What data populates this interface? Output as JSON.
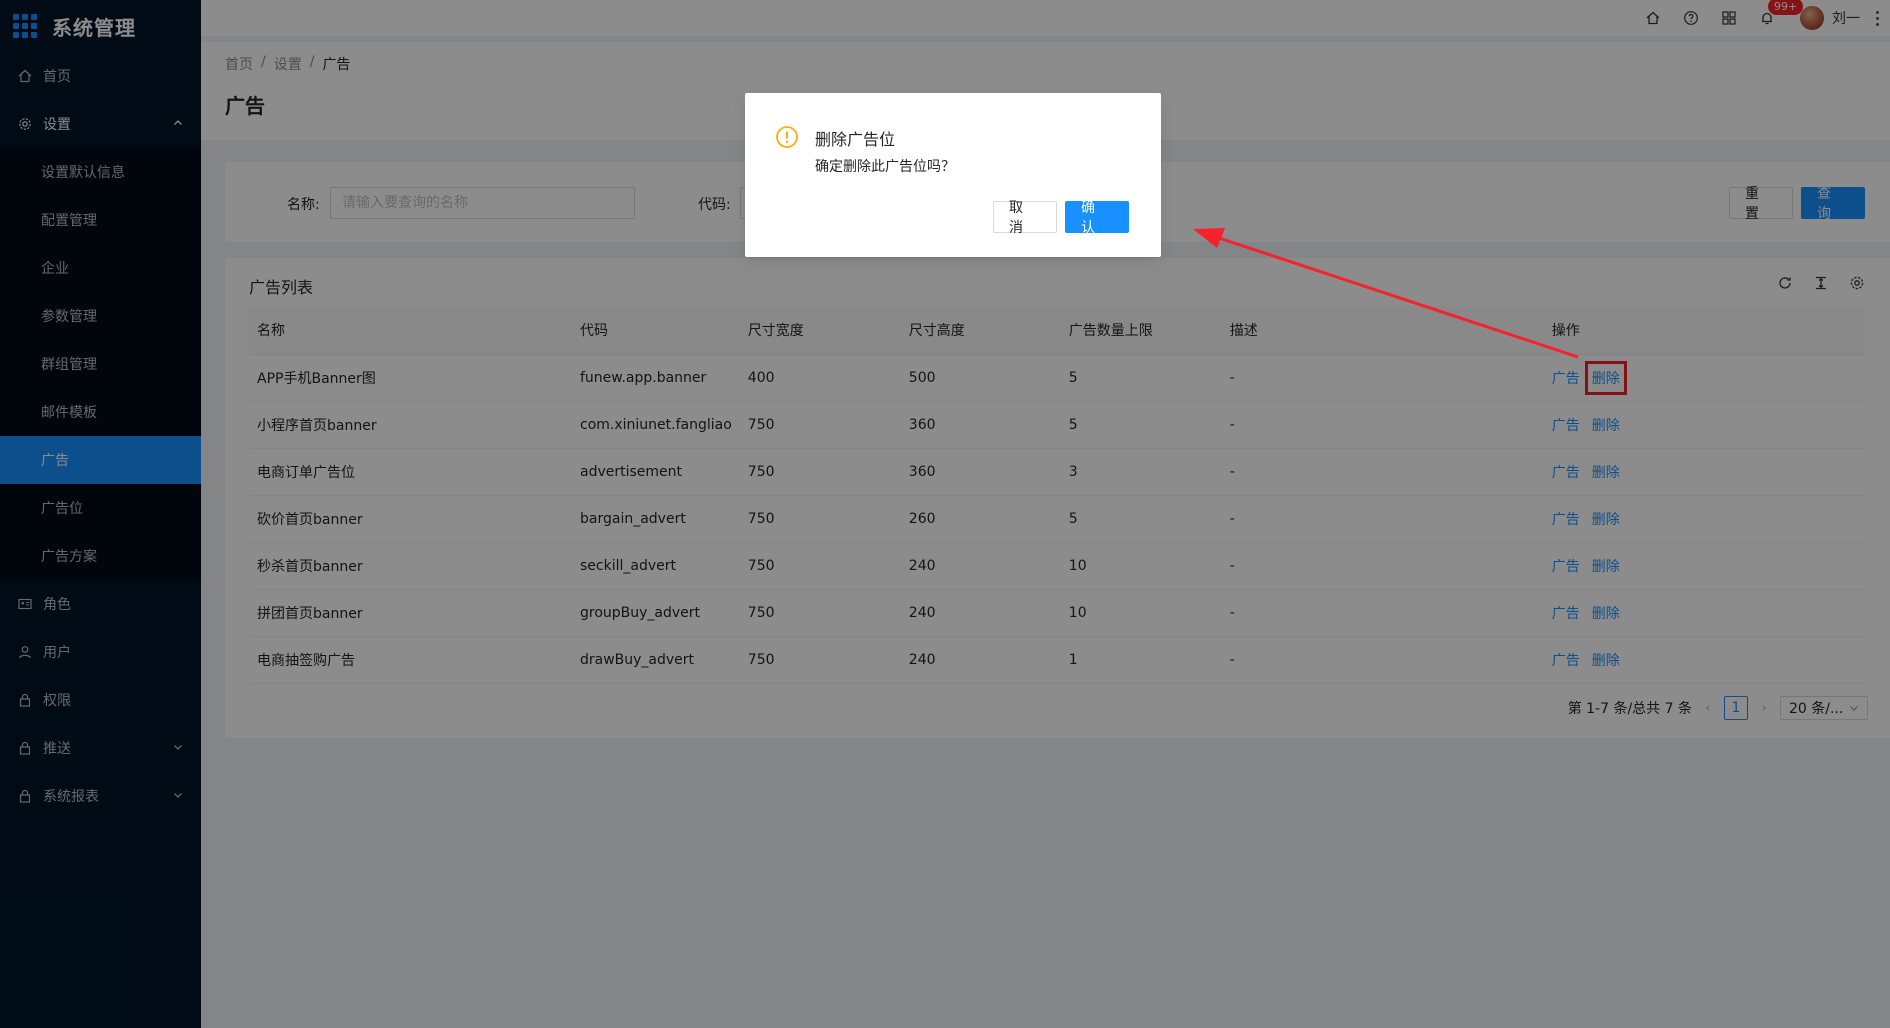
{
  "app": {
    "title": "系统管理"
  },
  "sidebar": {
    "items": [
      {
        "label": "首页",
        "icon": "home-icon"
      },
      {
        "label": "设置",
        "icon": "gear-icon",
        "open": true,
        "children": [
          {
            "label": "设置默认信息"
          },
          {
            "label": "配置管理"
          },
          {
            "label": "企业"
          },
          {
            "label": "参数管理"
          },
          {
            "label": "群组管理"
          },
          {
            "label": "邮件模板"
          },
          {
            "label": "广告",
            "active": true
          },
          {
            "label": "广告位"
          },
          {
            "label": "广告方案"
          }
        ]
      },
      {
        "label": "角色",
        "icon": "id-card-icon"
      },
      {
        "label": "用户",
        "icon": "user-icon"
      },
      {
        "label": "权限",
        "icon": "lock-icon"
      },
      {
        "label": "推送",
        "icon": "lock-icon",
        "expandable": true
      },
      {
        "label": "系统报表",
        "icon": "lock-icon",
        "expandable": true
      }
    ]
  },
  "header": {
    "notification_badge": "99+",
    "user_name": "刘一"
  },
  "breadcrumb": [
    "首页",
    "设置",
    "广告"
  ],
  "page_title": "广告",
  "search": {
    "name_label": "名称:",
    "name_placeholder": "请输入要查询的名称",
    "code_label": "代码:",
    "reset_label": "重 置",
    "query_label": "查 询"
  },
  "table": {
    "title": "广告列表",
    "columns": [
      "名称",
      "代码",
      "尺寸宽度",
      "尺寸高度",
      "广告数量上限",
      "描述",
      "操作"
    ],
    "rows": [
      [
        "APP手机Banner图",
        "funew.app.banner",
        "400",
        "500",
        "5",
        "-"
      ],
      [
        "小程序首页banner",
        "com.xiniunet.fangliao",
        "750",
        "360",
        "5",
        "-"
      ],
      [
        "电商订单广告位",
        "advertisement",
        "750",
        "360",
        "3",
        "-"
      ],
      [
        "砍价首页banner",
        "bargain_advert",
        "750",
        "260",
        "5",
        "-"
      ],
      [
        "秒杀首页banner",
        "seckill_advert",
        "750",
        "240",
        "10",
        "-"
      ],
      [
        "拼团首页banner",
        "groupBuy_advert",
        "750",
        "240",
        "10",
        "-"
      ],
      [
        "电商抽签购广告",
        "drawBuy_advert",
        "750",
        "240",
        "1",
        "-"
      ]
    ],
    "op_ad": "广告",
    "op_delete": "删除"
  },
  "pagination": {
    "summary": "第 1-7 条/总共 7 条",
    "current": "1",
    "page_size": "20 条/..."
  },
  "modal": {
    "title": "删除广告位",
    "content": "确定删除此广告位吗？",
    "cancel_label": "取 消",
    "confirm_label": "确 认"
  },
  "colors": {
    "primary": "#1890ff",
    "sidebar": "#001529",
    "warning": "#faad14",
    "annotation": "#f5222d"
  }
}
